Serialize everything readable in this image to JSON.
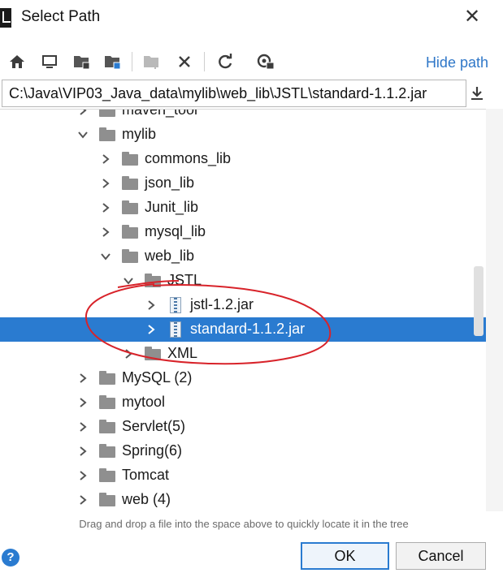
{
  "window": {
    "title": "Select Path"
  },
  "toolbar": {
    "icons": [
      "home-icon",
      "desktop-icon",
      "project-folder-icon",
      "module-folder-icon",
      "new-folder-icon",
      "delete-icon",
      "refresh-icon",
      "show-hidden-icon"
    ],
    "hide_path_label": "Hide path"
  },
  "path": {
    "value": "C:\\Java\\VIP03_Java_data\\mylib\\web_lib\\JSTL\\standard-1.1.2.jar"
  },
  "tree": {
    "rows": [
      {
        "label": "maven_tool",
        "type": "folder",
        "state": "collapsed",
        "level": 2
      },
      {
        "label": "mylib",
        "type": "folder",
        "state": "expanded",
        "level": 2
      },
      {
        "label": "commons_lib",
        "type": "folder",
        "state": "collapsed",
        "level": 3
      },
      {
        "label": "json_lib",
        "type": "folder",
        "state": "collapsed",
        "level": 3
      },
      {
        "label": "Junit_lib",
        "type": "folder",
        "state": "collapsed",
        "level": 3
      },
      {
        "label": "mysql_lib",
        "type": "folder",
        "state": "collapsed",
        "level": 3
      },
      {
        "label": "web_lib",
        "type": "folder",
        "state": "expanded",
        "level": 3
      },
      {
        "label": "JSTL",
        "type": "folder",
        "state": "expanded",
        "level": 4
      },
      {
        "label": "jstl-1.2.jar",
        "type": "jar",
        "state": "collapsed",
        "level": 5
      },
      {
        "label": "standard-1.1.2.jar",
        "type": "jar",
        "state": "collapsed",
        "level": 5,
        "selected": true
      },
      {
        "label": "XML",
        "type": "folder",
        "state": "collapsed",
        "level": 4
      },
      {
        "label": "MySQL (2)",
        "type": "folder",
        "state": "collapsed",
        "level": 2
      },
      {
        "label": "mytool",
        "type": "folder",
        "state": "collapsed",
        "level": 2
      },
      {
        "label": "Servlet(5)",
        "type": "folder",
        "state": "collapsed",
        "level": 2
      },
      {
        "label": "Spring(6)",
        "type": "folder",
        "state": "collapsed",
        "level": 2
      },
      {
        "label": "Tomcat",
        "type": "folder",
        "state": "collapsed",
        "level": 2
      },
      {
        "label": "web (4)",
        "type": "folder",
        "state": "collapsed",
        "level": 2
      },
      {
        "label": "",
        "type": "folder",
        "state": "collapsed",
        "level": 2
      }
    ]
  },
  "hint": "Drag and drop a file into the space above to quickly locate it in the tree",
  "buttons": {
    "ok": "OK",
    "cancel": "Cancel",
    "help": "?"
  },
  "colors": {
    "selection": "#2a7bd0",
    "link": "#2f77c8",
    "annotation": "#d8232a"
  }
}
